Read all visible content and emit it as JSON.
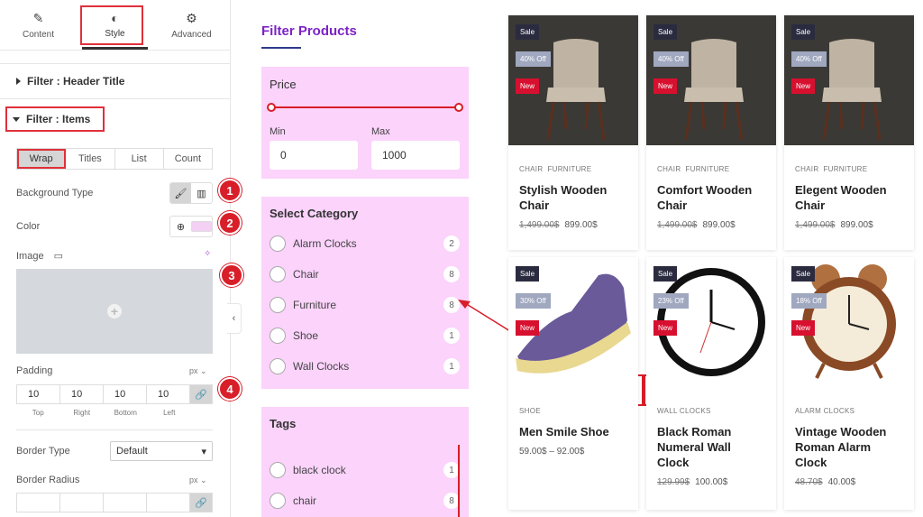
{
  "panel": {
    "tabs": [
      {
        "label": "Content",
        "icon": "pencil-icon"
      },
      {
        "label": "Style",
        "icon": "half-circle-icon"
      },
      {
        "label": "Advanced",
        "icon": "gear-icon"
      }
    ],
    "section_header_title": "Filter : Header Title",
    "section_items": "Filter : Items",
    "subtabs": [
      "Wrap",
      "Titles",
      "List",
      "Count"
    ],
    "background_type_label": "Background Type",
    "color_label": "Color",
    "image_label": "Image",
    "padding_label": "Padding",
    "padding_unit": "px",
    "padding_values": [
      "10",
      "10",
      "10",
      "10"
    ],
    "padding_sides": [
      "Top",
      "Right",
      "Bottom",
      "Left"
    ],
    "border_type_label": "Border Type",
    "border_type_value": "Default",
    "border_radius_label": "Border Radius",
    "border_radius_unit": "px",
    "badges": [
      "1",
      "2",
      "3",
      "4"
    ],
    "swatch_color": "#f4d0f4"
  },
  "filter": {
    "title": "Filter Products",
    "price_title": "Price",
    "min_label": "Min",
    "max_label": "Max",
    "min_value": "0",
    "max_value": "1000",
    "category_title": "Select Category",
    "categories": [
      {
        "name": "Alarm Clocks",
        "count": "2"
      },
      {
        "name": "Chair",
        "count": "8"
      },
      {
        "name": "Furniture",
        "count": "8"
      },
      {
        "name": "Shoe",
        "count": "1"
      },
      {
        "name": "Wall Clocks",
        "count": "1"
      }
    ],
    "tags_title": "Tags",
    "tags": [
      {
        "name": "black clock",
        "count": "1"
      },
      {
        "name": "chair",
        "count": "8"
      }
    ],
    "box_color": "#fbd3fb"
  },
  "annotation_numbers": [
    "2",
    "3",
    "4"
  ],
  "products": [
    {
      "sale": "Sale",
      "off": "40% Off",
      "new": "New",
      "cat1": "CHAIR",
      "cat2": "FURNITURE",
      "name": "Stylish Wooden Chair",
      "old": "1,499.00$",
      "price": "899.00$"
    },
    {
      "sale": "Sale",
      "off": "40% Off",
      "new": "New",
      "cat1": "CHAIR",
      "cat2": "FURNITURE",
      "name": "Comfort Wooden Chair",
      "old": "1,499.00$",
      "price": "899.00$"
    },
    {
      "sale": "Sale",
      "off": "40% Off",
      "new": "New",
      "cat1": "CHAIR",
      "cat2": "FURNITURE",
      "name": "Elegent Wooden Chair",
      "old": "1,499.00$",
      "price": "899.00$"
    },
    {
      "sale": "Sale",
      "off": "30% Off",
      "new": "New",
      "cat1": "SHOE",
      "cat2": "",
      "name": "Men Smile Shoe",
      "old": "",
      "price": "59.00$ – 92.00$"
    },
    {
      "sale": "Sale",
      "off": "23% Off",
      "new": "New",
      "cat1": "WALL CLOCKS",
      "cat2": "",
      "name": "Black Roman Numeral Wall Clock",
      "old": "129.99$",
      "price": "100.00$"
    },
    {
      "sale": "Sale",
      "off": "18% Off",
      "new": "New",
      "cat1": "ALARM CLOCKS",
      "cat2": "",
      "name": "Vintage Wooden Roman Alarm Clock",
      "old": "48.70$",
      "price": "40.00$"
    }
  ]
}
